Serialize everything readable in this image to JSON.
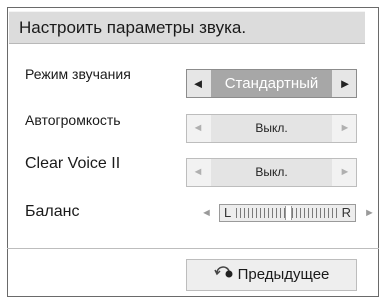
{
  "title": "Настроить параметры звука.",
  "rows": [
    {
      "label": "Режим звучания",
      "value": "Стандартный",
      "active": true
    },
    {
      "label": "Автогромкость",
      "value": "Выкл.",
      "active": false
    },
    {
      "label": "Clear Voice II",
      "value": "Выкл.",
      "active": false
    },
    {
      "label": "Баланс",
      "balance_left": "L",
      "balance_right": "R",
      "balance_position": 0.5
    }
  ],
  "back_button": {
    "label": "Предыдущее",
    "icon": "return-arrow-icon"
  },
  "arrows": {
    "left": "◄",
    "right": "►"
  },
  "colors": {
    "active_value_bg": "#a7a7a7",
    "title_bg": "#dcdcdc"
  }
}
